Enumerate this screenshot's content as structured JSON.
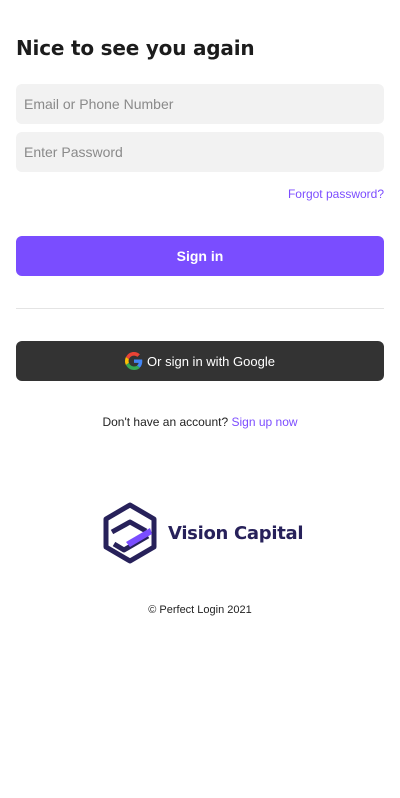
{
  "header": {
    "title": "Nice to see you again"
  },
  "form": {
    "email_placeholder": "Email or Phone Number",
    "password_placeholder": "Enter Password",
    "forgot_label": "Forgot password?",
    "signin_label": "Sign in",
    "google_label": "Or sign in with Google"
  },
  "signup": {
    "prompt": "Don't have an account?",
    "link_label": "Sign up now"
  },
  "brand": {
    "name": "Vision Capital"
  },
  "footer": {
    "copyright": "© Perfect Login 2021"
  },
  "colors": {
    "accent": "#7a4dff",
    "dark_button": "#333333",
    "brand_navy": "#27215a",
    "field_bg": "#f2f2f2"
  },
  "icons": [
    "google-icon",
    "vision-capital-logo-icon"
  ]
}
